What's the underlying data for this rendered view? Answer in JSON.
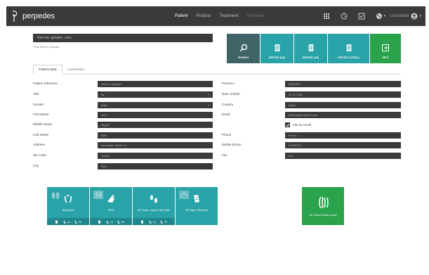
{
  "navbar": {
    "brand": "perpedes",
    "links": [
      "Patient",
      "Product",
      "Treatment",
      "Overview"
    ],
    "user_name": "consultant",
    "icons": [
      "grid-icon",
      "clock-icon",
      "checklist-icon",
      "globe-icon",
      "user-icon"
    ]
  },
  "header": {
    "title_value": "New for updates .com",
    "required_note": "*This field is required"
  },
  "actions": {
    "search": "SEARCH",
    "report1": "REPORT (A4)",
    "report2": "REPORT (A5)",
    "report3": "REPORT (LEGAL)",
    "next": "NEXT"
  },
  "tabs": {
    "patient_data": "Patient data",
    "anamnesis": "Anamnesis"
  },
  "form": {
    "left": [
      {
        "label": "Patient reference",
        "value": "New for updates"
      },
      {
        "label": "Title",
        "value": "Mr"
      },
      {
        "label": "Gender",
        "value": "Male"
      },
      {
        "label": "First Name",
        "value": "John"
      },
      {
        "label": "Middle Name",
        "value": "Miguel"
      },
      {
        "label": "Last Name",
        "value": "Rich"
      },
      {
        "label": "Address",
        "value": "Innovation Street 12"
      },
      {
        "label": "Zip Code",
        "value": "12345"
      },
      {
        "label": "City",
        "value": "Bern"
      }
    ],
    "right": [
      {
        "label": "Province",
        "value": "BURGER"
      },
      {
        "label": "Date of Birth",
        "value": "01.01.1980"
      },
      {
        "label": "Country",
        "value": "Spain"
      },
      {
        "label": "Email",
        "value": "patient@perpedes.com"
      },
      {
        "label": "Phone",
        "value": "Phone"
      },
      {
        "label": "Mobile phone",
        "value": "12345678"
      },
      {
        "label": "Fax",
        "value": "Fax"
      }
    ],
    "info_by_email": "Info by email"
  },
  "tiles": [
    {
      "name": "Blueprint",
      "icon": "footprint-icon"
    },
    {
      "name": "APS",
      "icon": "foot-scan-icon"
    },
    {
      "name": "I/O Scan / Import 3D Data",
      "icon": "footsteps-icon"
    },
    {
      "name": "3D Data, Rearfoot",
      "icon": "document-icon"
    }
  ],
  "tile_actions": {
    "delete": "",
    "left": "Le",
    "right": "Ri"
  },
  "import_tile": {
    "name": "3D Insole Data Import",
    "icon": "insole-icon"
  },
  "colors": {
    "navbar": "#3a3a3a",
    "field": "#3a3a3a",
    "teal": "#2aa3a8",
    "green": "#2ba24c",
    "slate": "#3f6468"
  }
}
